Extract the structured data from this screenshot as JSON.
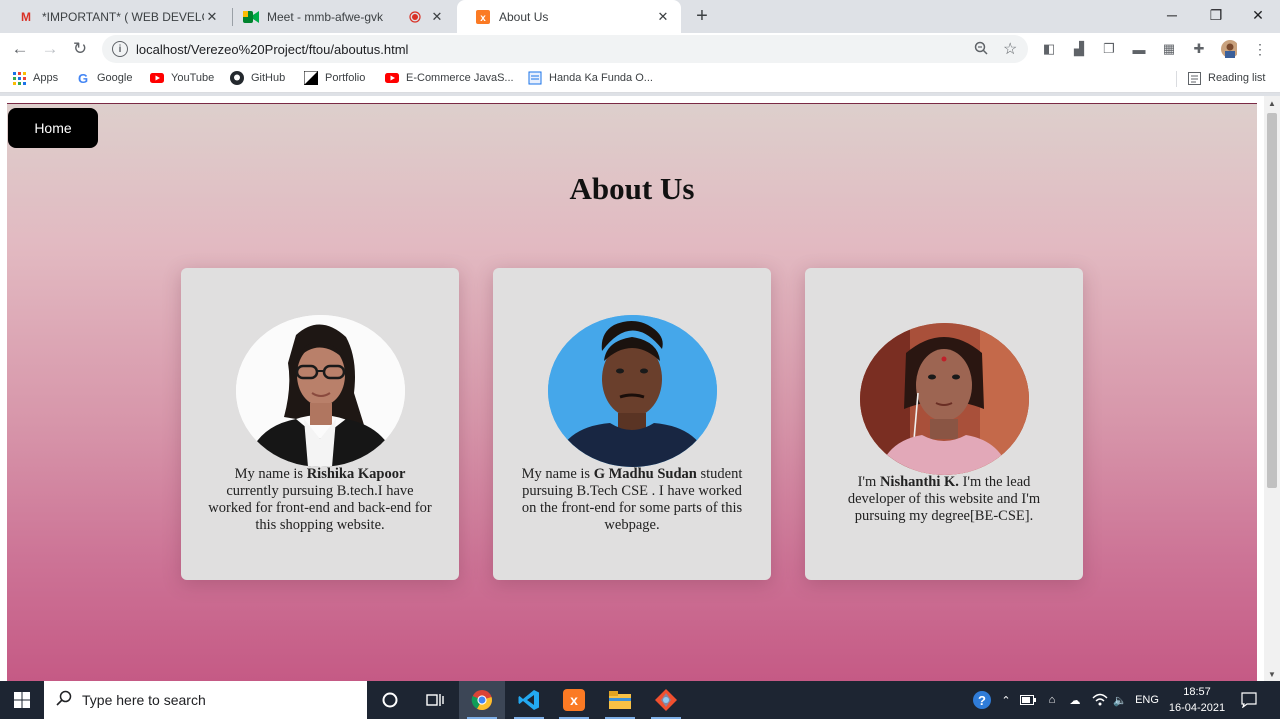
{
  "browser": {
    "tabs": [
      {
        "title": "*IMPORTANT* ( WEB DEVELOPM",
        "favicon": "gmail-icon"
      },
      {
        "title": "Meet - mmb-afwe-gvk",
        "favicon": "meet-icon"
      },
      {
        "title": "About Us",
        "favicon": "xampp-icon"
      }
    ],
    "new_tab": "+",
    "url": "localhost/Verezeo%20Project/ftou/aboutus.html",
    "bookmarks": [
      {
        "label": "Apps"
      },
      {
        "label": "Google"
      },
      {
        "label": "YouTube"
      },
      {
        "label": "GitHub"
      },
      {
        "label": "Portfolio"
      },
      {
        "label": "E-Commerce JavaS..."
      },
      {
        "label": "Handa Ka Funda O..."
      }
    ],
    "reading_list": "Reading list"
  },
  "page": {
    "home_button": "Home",
    "heading": "About Us",
    "cards": [
      {
        "pre": "My name is ",
        "name": "Rishika Kapoor",
        "post": " currently pursuing B.tech.I have worked for front-end and back-end for this shopping website."
      },
      {
        "pre": "My name is ",
        "name": "G Madhu Sudan",
        "post": " student pursuing B.Tech CSE . I have worked on the front-end for some parts of this webpage."
      },
      {
        "pre": "I'm ",
        "name": "Nishanthi K.",
        "post": " I'm the lead developer of this website and I'm pursuing my degree[BE-CSE]."
      }
    ],
    "colors": {
      "background_top": "#ddcfcc",
      "background_bottom": "#c55a85",
      "card": "#e0dfdf",
      "button": "#000000"
    }
  },
  "taskbar": {
    "search_placeholder": "Type here to search",
    "language": "ENG",
    "time": "18:57",
    "date": "16-04-2021"
  }
}
